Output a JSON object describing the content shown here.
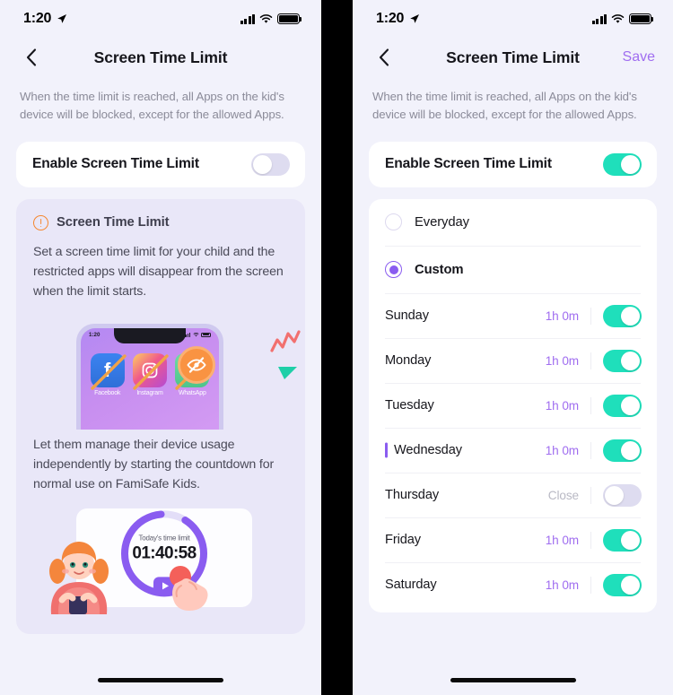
{
  "status_bar": {
    "time": "1:20",
    "location_icon": "location-arrow-icon",
    "signal_icon": "cellular-bars-icon",
    "wifi_icon": "wifi-icon",
    "battery_icon": "battery-full-icon"
  },
  "left_panel": {
    "nav": {
      "back_icon": "chevron-left-icon",
      "title": "Screen Time Limit"
    },
    "description": "When the time limit is reached, all Apps on the kid's device will be blocked, except for the allowed Apps.",
    "enable_row": {
      "label": "Enable Screen Time Limit",
      "toggle_state": "off"
    },
    "info_card": {
      "warning_icon": "exclamation-circle-icon",
      "title": "Screen Time Limit",
      "body": "Set a screen time limit for your child and the restricted apps will disappear from the screen when the limit starts.",
      "phone_mockup": {
        "status_time": "1:20",
        "apps": [
          {
            "name": "Facebook",
            "glyph": "f",
            "blocked": true
          },
          {
            "name": "Instagram",
            "glyph": "◎",
            "blocked": true
          },
          {
            "name": "WhatsApp",
            "glyph": "◌",
            "blocked": true
          }
        ],
        "badge_icon": "eye-slash-icon"
      },
      "body2": "Let them manage their device usage independently by starting the countdown for normal use on FamiSafe Kids.",
      "timer_card": {
        "ring_label": "Today's time limit",
        "countdown": "01:40:58",
        "play_icon": "play-icon",
        "girl_illustration": "girl-with-phone-illustration",
        "hand_illustration": "hand-tapping-illustration"
      }
    }
  },
  "right_panel": {
    "nav": {
      "back_icon": "chevron-left-icon",
      "title": "Screen Time Limit",
      "save_label": "Save"
    },
    "description": "When the time limit is reached, all Apps on the kid's device will be blocked, except for the allowed Apps.",
    "enable_row": {
      "label": "Enable Screen Time Limit",
      "toggle_state": "on"
    },
    "schedule_options": [
      {
        "label": "Everyday",
        "selected": false
      },
      {
        "label": "Custom",
        "selected": true
      }
    ],
    "days": [
      {
        "name": "Sunday",
        "value": "1h 0m",
        "toggle_state": "on",
        "active_marker": false
      },
      {
        "name": "Monday",
        "value": "1h 0m",
        "toggle_state": "on",
        "active_marker": false
      },
      {
        "name": "Tuesday",
        "value": "1h 0m",
        "toggle_state": "on",
        "active_marker": false
      },
      {
        "name": "Wednesday",
        "value": "1h 0m",
        "toggle_state": "on",
        "active_marker": true
      },
      {
        "name": "Thursday",
        "value": "Close",
        "toggle_state": "off",
        "active_marker": false
      },
      {
        "name": "Friday",
        "value": "1h 0m",
        "toggle_state": "on",
        "active_marker": false
      },
      {
        "name": "Saturday",
        "value": "1h 0m",
        "toggle_state": "on",
        "active_marker": false
      }
    ]
  },
  "colors": {
    "page_background": "#f2f2fb",
    "card_background": "#ffffff",
    "info_card_background": "#e9e7f8",
    "accent_purple": "#8a5cf0",
    "value_purple": "#a06ef0",
    "toggle_on_green": "#1fdfbb",
    "toggle_off_grey": "#dedcf0",
    "warning_orange": "#f5872f",
    "muted_text": "#8b8b99"
  }
}
